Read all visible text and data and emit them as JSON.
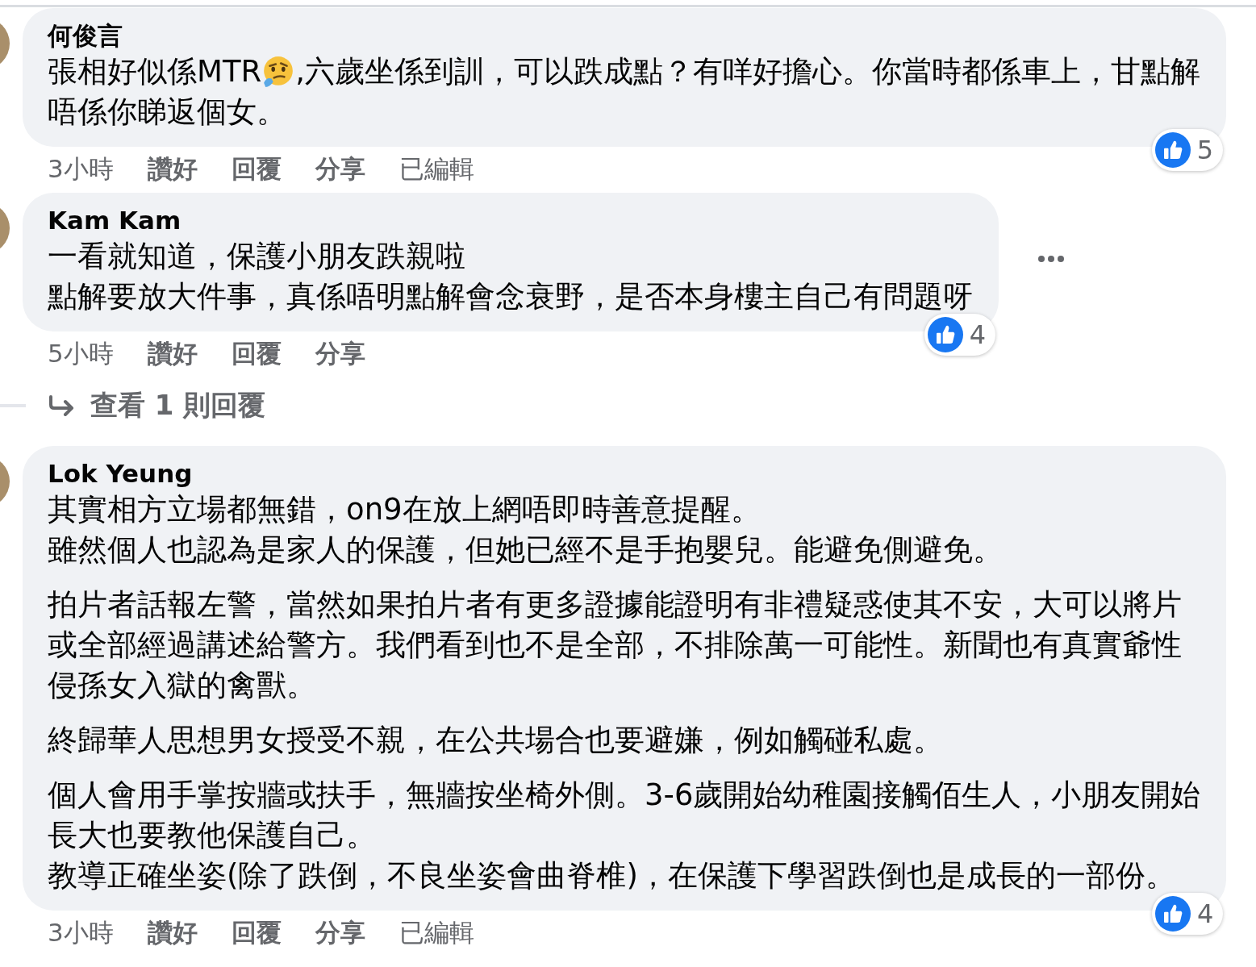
{
  "comments": [
    {
      "author": "何俊言",
      "paragraphs": [
        [
          {
            "parts": [
              {
                "kind": "text",
                "text": "張相好似係MTR"
              },
              {
                "kind": "emoji"
              },
              {
                "kind": "text",
                "text": ",六歲坐係到訓，可以跌成點？有咩好擔心。你當時都係車上，甘點解"
              }
            ]
          },
          "唔係你睇返個女。"
        ]
      ],
      "reactions": "5",
      "more_button": false,
      "time": "3小時",
      "actions": [
        "讚好",
        "回覆",
        "分享"
      ],
      "edited": "已編輯"
    },
    {
      "author": "Kam Kam",
      "paragraphs": [
        [
          "一看就知道，保護小朋友跌親啦",
          "點解要放大件事，真係唔明點解會念衰野，是否本身樓主自己有問題呀"
        ]
      ],
      "reactions": "4",
      "more_button": true,
      "time": "5小時",
      "actions": [
        "讚好",
        "回覆",
        "分享"
      ],
      "replies_link": "查看 1 則回覆"
    },
    {
      "author": "Lok Yeung",
      "paragraphs": [
        [
          "其實相方立場都無錯，on9在放上網唔即時善意提醒。",
          "雖然個人也認為是家人的保護，但她已經不是手抱嬰兒。能避免側避免。"
        ],
        [
          "拍片者話報左警，當然如果拍片者有更多證據能證明有非禮疑惑使其不安，大可以將片",
          "或全部經過講述給警方。我們看到也不是全部，不排除萬一可能性。新聞也有真實爺性",
          "侵孫女入獄的禽獸。"
        ],
        [
          "終歸華人思想男女授受不親，在公共場合也要避嫌，例如觸碰私處。"
        ],
        [
          "個人會用手掌按牆或扶手，無牆按坐椅外側。3-6歲開始幼稚園接觸佰生人，小朋友開始",
          "長大也要教他保護自己。",
          "教導正確坐姿(除了跌倒，不良坐姿會曲脊椎)，在保護下學習跌倒也是成長的一部份。"
        ]
      ],
      "reactions": "4",
      "more_button": false,
      "time": "3小時",
      "actions": [
        "讚好",
        "回覆",
        "分享"
      ],
      "edited": "已編輯"
    }
  ]
}
